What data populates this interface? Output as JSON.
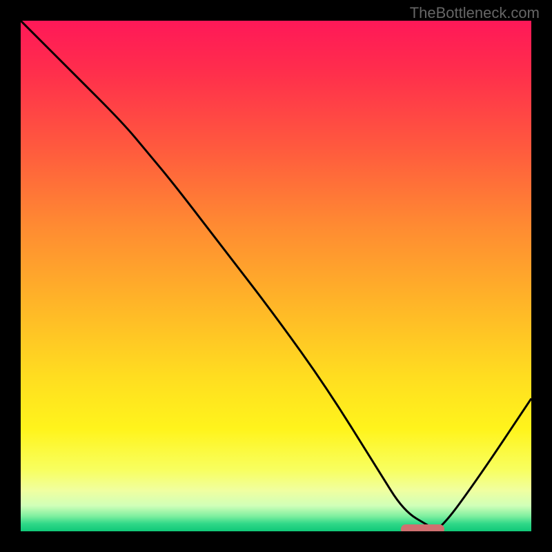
{
  "watermark": "TheBottleneck.com",
  "chart_data": {
    "type": "line",
    "title": "",
    "xlabel": "",
    "ylabel": "",
    "xlim": [
      0,
      100
    ],
    "ylim": [
      0,
      100
    ],
    "series": [
      {
        "name": "bottleneck-curve",
        "x": [
          0,
          10,
          20,
          25,
          30,
          40,
          50,
          60,
          70,
          75,
          80,
          82,
          90,
          100
        ],
        "values": [
          100,
          90,
          80,
          74,
          68,
          55,
          42,
          28,
          12,
          4,
          1,
          0,
          11,
          26
        ]
      }
    ],
    "marker": {
      "name": "optimal-range",
      "x_start": 74.5,
      "x_end": 83,
      "y": 0
    },
    "background_gradient": {
      "stops": [
        {
          "pos": 0.0,
          "color": "#ff1858"
        },
        {
          "pos": 0.1,
          "color": "#ff2e4c"
        },
        {
          "pos": 0.25,
          "color": "#ff5a3e"
        },
        {
          "pos": 0.4,
          "color": "#ff8a32"
        },
        {
          "pos": 0.55,
          "color": "#ffb428"
        },
        {
          "pos": 0.7,
          "color": "#ffde20"
        },
        {
          "pos": 0.8,
          "color": "#fff41c"
        },
        {
          "pos": 0.88,
          "color": "#f8ff60"
        },
        {
          "pos": 0.92,
          "color": "#f0ffa0"
        },
        {
          "pos": 0.95,
          "color": "#d0ffb8"
        },
        {
          "pos": 0.97,
          "color": "#80f0a0"
        },
        {
          "pos": 0.985,
          "color": "#30d888"
        },
        {
          "pos": 1.0,
          "color": "#10c878"
        }
      ]
    }
  }
}
